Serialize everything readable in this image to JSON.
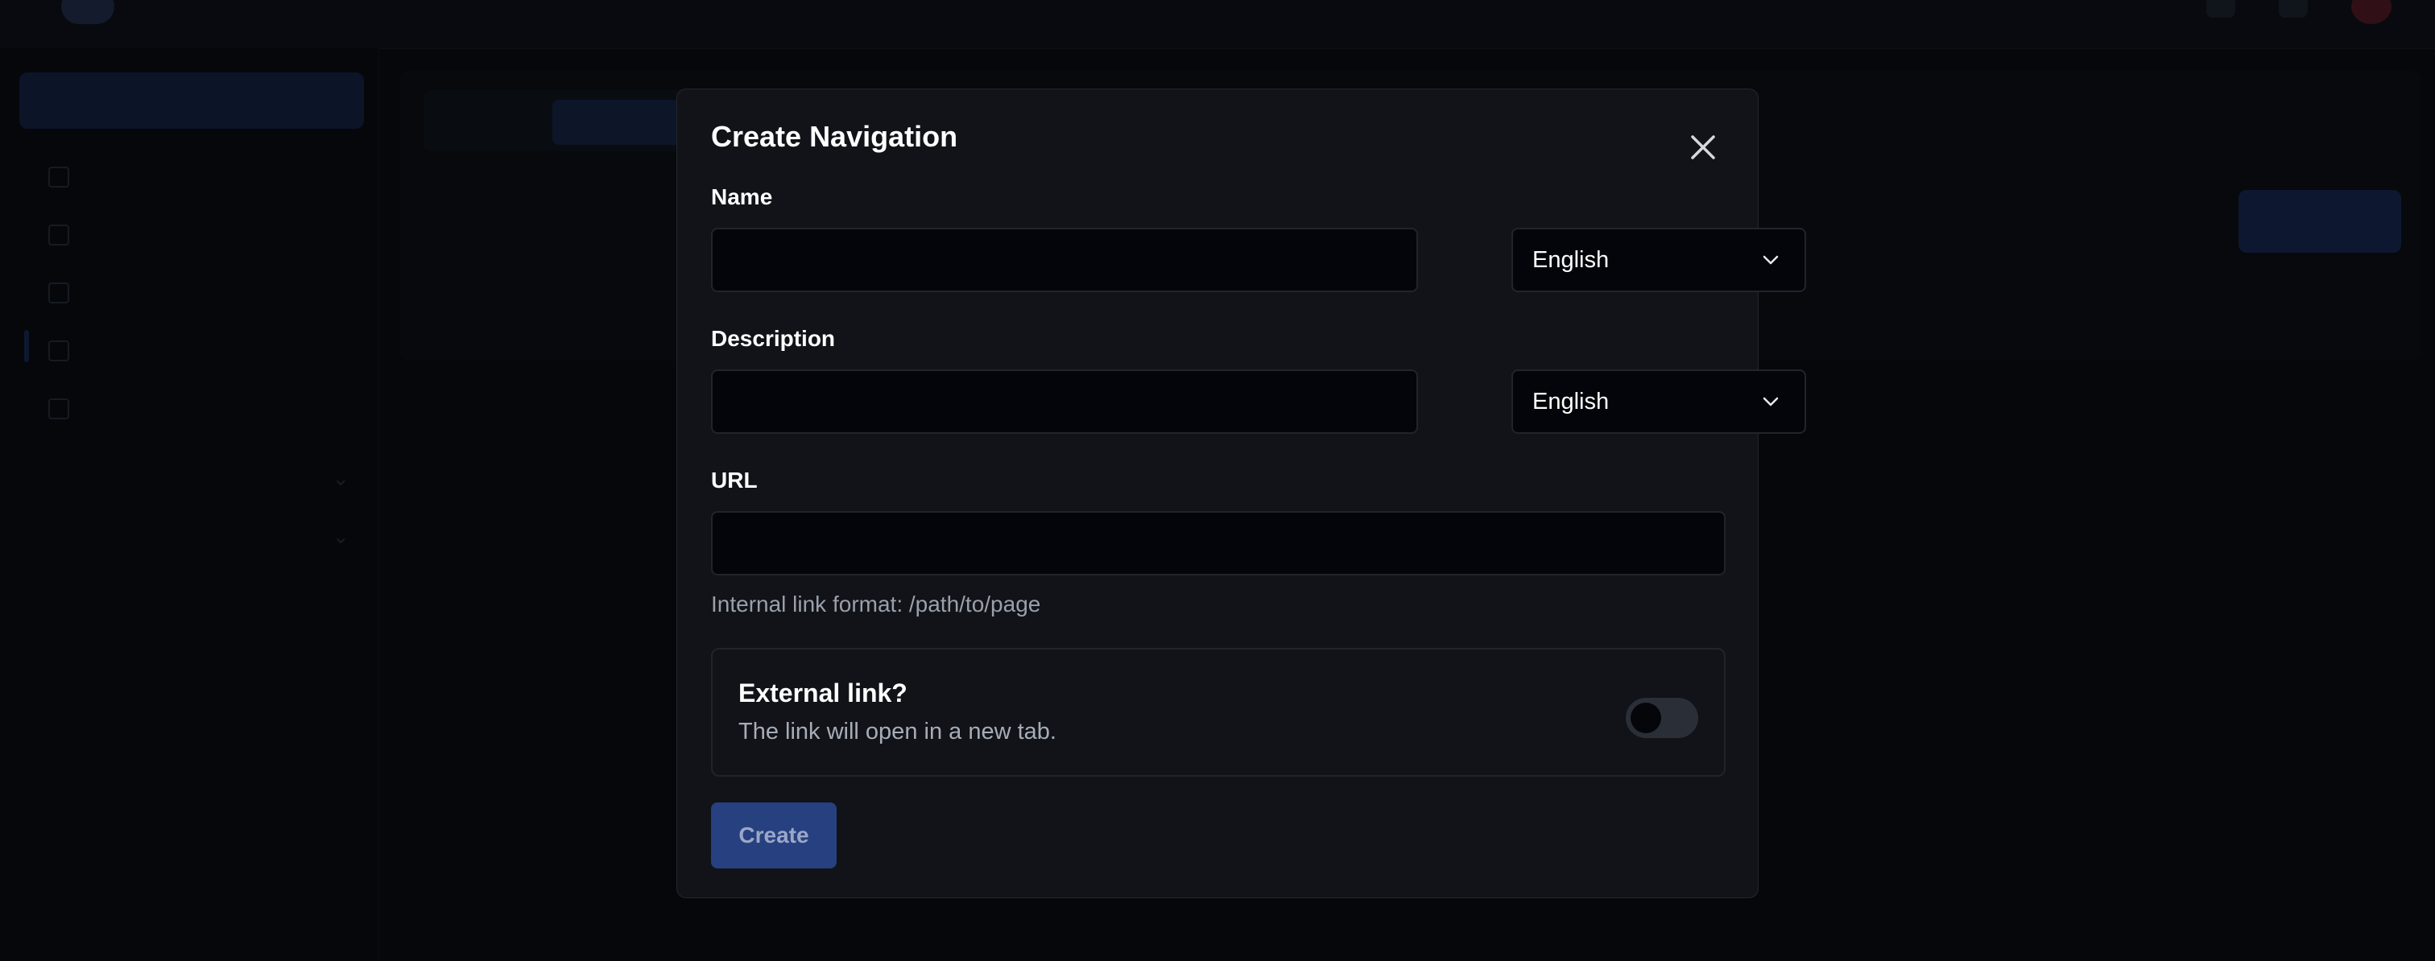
{
  "modal": {
    "title": "Create Navigation",
    "name_label": "Name",
    "name_value": "",
    "name_language": "English",
    "description_label": "Description",
    "description_value": "",
    "description_language": "English",
    "url_label": "URL",
    "url_value": "",
    "url_hint": "Internal link format: /path/to/page",
    "external_title": "External link?",
    "external_description": "The link will open in a new tab.",
    "external_enabled": false,
    "create_label": "Create"
  },
  "colors": {
    "primary_button": "#27407f",
    "modal_bg": "#111318",
    "input_bg": "#04050a"
  },
  "icons": {
    "close": "close-icon",
    "dropdown": "chevron-down-icon"
  }
}
